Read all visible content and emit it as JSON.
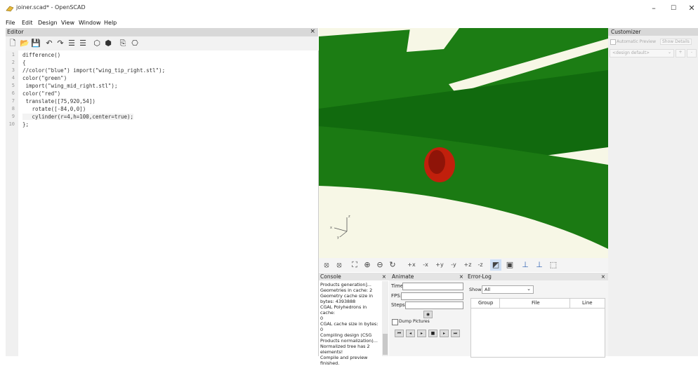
{
  "window": {
    "title": "joiner.scad* - OpenSCAD",
    "minimize": "–",
    "maximize": "☐",
    "close": "✕"
  },
  "menu": [
    "File",
    "Edit",
    "Design",
    "View",
    "Window",
    "Help"
  ],
  "editor": {
    "header": "Editor",
    "close": "×",
    "toolbar_icons": [
      "new-file-icon",
      "open-file-icon",
      "save-icon",
      "undo-icon",
      "redo-icon",
      "unindent-icon",
      "indent-icon",
      "preview-icon",
      "render-icon",
      "export-stl-icon",
      "send-to-print-icon"
    ],
    "lines": [
      {
        "n": "1",
        "text": "difference()"
      },
      {
        "n": "2",
        "text": "{"
      },
      {
        "n": "3",
        "text": "//color(\"blue\") import(\"wing_tip_right.stl\");"
      },
      {
        "n": "4",
        "text": "color(\"green\")"
      },
      {
        "n": "5",
        "text": " import(\"wing_mid_right.stl\");"
      },
      {
        "n": "6",
        "text": "color(\"red\")"
      },
      {
        "n": "7",
        "text": " translate([75,920,54])"
      },
      {
        "n": "8",
        "text": "   rotate([-84,0,0])"
      },
      {
        "n": "9",
        "text": "   cylinder(r=4,h=100,center=true);"
      },
      {
        "n": "10",
        "text": "};"
      }
    ]
  },
  "viewport": {
    "axis_labels": {
      "x": "x",
      "y": "y",
      "z": "z"
    },
    "colors": {
      "background": "#f7f7e6",
      "green": "#1a7a13",
      "dark_green": "#0f5c0c",
      "red": "#c1200c"
    }
  },
  "view_toolbar": [
    "⦻",
    "⦻",
    "⛶",
    "⊕",
    "⊖",
    "↻",
    "+x",
    "-x",
    "+y",
    "-y",
    "+z",
    "-z",
    "◩",
    "▣",
    "⊥",
    "⊥",
    "⬚"
  ],
  "console": {
    "header": "Console",
    "close": "×",
    "lines": [
      "Products generation]...",
      "Geometries in cache: 2",
      "Geometry cache size in",
      "bytes: 4393888",
      "CGAL Polyhedrons in cache:",
      "0",
      "CGAL cache size in bytes: 0",
      "Compiling design (CSG",
      "Products normalization)...",
      "Normalized tree has 2",
      "elements!",
      "Compile and preview",
      "finished."
    ]
  },
  "animate": {
    "header": "Animate",
    "close": "×",
    "time_label": "Time:",
    "fps_label": "FPS:",
    "steps_label": "Steps:",
    "dump_label": "Dump Pictures"
  },
  "errorlog": {
    "header": "Error-Log",
    "close": "×",
    "show_label": "Show",
    "show_value": "All",
    "columns": [
      "Group",
      "File",
      "Line"
    ]
  },
  "customizer": {
    "header": "Customizer",
    "auto_preview": "Automatic Preview",
    "show_details": "Show Details",
    "preset": "<design default>",
    "add": "+",
    "remove": "-"
  }
}
